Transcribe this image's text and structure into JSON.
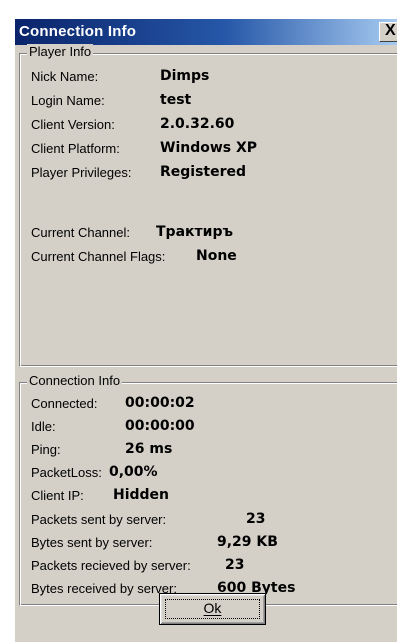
{
  "window": {
    "title": "Connection Info",
    "close_glyph": "X"
  },
  "player_info": {
    "legend": "Player Info",
    "rows": [
      {
        "label": "Nick Name:",
        "value": "Dimps"
      },
      {
        "label": "Login Name:",
        "value": "test"
      },
      {
        "label": "Client Version:",
        "value": "2.0.32.60"
      },
      {
        "label": "Client Platform:",
        "value": "Windows XP"
      },
      {
        "label": "Player Privileges:",
        "value": "Registered"
      }
    ],
    "channel": {
      "label": "Current Channel:",
      "value": "Трактиръ"
    },
    "channel_flags": {
      "label": "Current Channel Flags:",
      "value": "None"
    }
  },
  "connection_info": {
    "legend": "Connection Info",
    "rows": [
      {
        "label": "Connected:",
        "value": "00:00:02"
      },
      {
        "label": "Idle:",
        "value": "00:00:00"
      },
      {
        "label": "Ping:",
        "value": "26 ms"
      },
      {
        "label": "PacketLoss:",
        "value": "0,00%"
      },
      {
        "label": "Client IP:",
        "value": "Hidden"
      },
      {
        "label": "Packets sent by server:",
        "value": "23"
      },
      {
        "label": "Bytes sent by server:",
        "value": "9,29 KB"
      },
      {
        "label": "Packets recieved by server:",
        "value": "23"
      },
      {
        "label": "Bytes received by server:",
        "value": "600 Bytes"
      }
    ]
  },
  "buttons": {
    "ok_label": "Ok"
  }
}
